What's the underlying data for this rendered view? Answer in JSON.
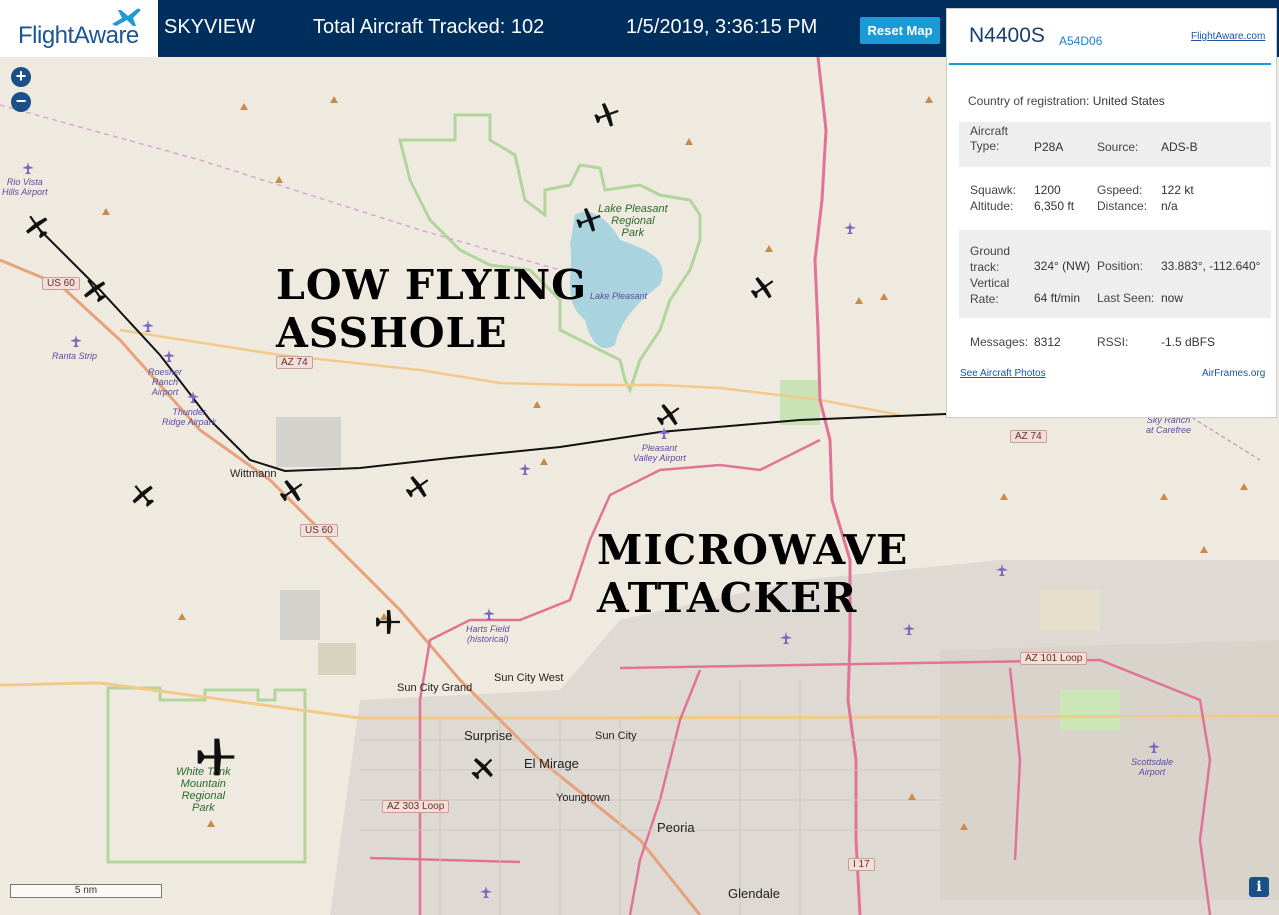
{
  "header": {
    "logo_text": "FlightAware",
    "app_name": "SKYVIEW",
    "tracked": "Total Aircraft Tracked: 102",
    "datetime": "1/5/2019, 3:36:15 PM",
    "reset_label": "Reset Map"
  },
  "map_controls": {
    "zoom_in": "+",
    "zoom_out": "−",
    "scale": "5 nm",
    "info": "i"
  },
  "annotations": {
    "low_flying_line1": "LOW FLYING",
    "low_flying_line2": "ASSHOLE",
    "microwave_line1": "MICROWAVE",
    "microwave_line2": "ATTACKER"
  },
  "map_labels": {
    "rio_vista": "Rio Vista\nHills Airport",
    "lake_pleasant_park": "Lake Pleasant\nRegional\nPark",
    "lake_pleasant": "Lake Pleasant",
    "ranta": "Ranta Strip",
    "roesner": "Roesner\nRanch\nAirport",
    "thunder": "Thunder\nRidge Airpark",
    "pleasant_valley": "Pleasant\nValley Airport",
    "sky_ranch": "Sky Ranch\nat Carefree",
    "wittmann": "Wittmann",
    "harts": "Harts Field\n(historical)",
    "sun_city_grand": "Sun City Grand",
    "sun_city_west": "Sun City West",
    "surprise": "Surprise",
    "sun_city": "Sun City",
    "el_mirage": "El Mirage",
    "youngtown": "Youngtown",
    "peoria": "Peoria",
    "glendale": "Glendale",
    "white_tank": "White Tank\nMountain\nRegional\nPark",
    "scottsdale": "Scottsdale\nAirport",
    "us60_a": "US 60",
    "us60_b": "US 60",
    "az74_a": "AZ 74",
    "az74_b": "AZ 74",
    "az101": "AZ 101 Loop",
    "az303": "AZ 303 Loop",
    "i17": "I 17"
  },
  "panel": {
    "registration": "N4400S",
    "hex": "A54D06",
    "site_link": "FlightAware.com",
    "country_label": "Country of registration:",
    "country_value": "United States",
    "aircraft_type_label": "Aircraft\nType:",
    "aircraft_type_value": "P28A",
    "source_label": "Source:",
    "source_value": "ADS-B",
    "squawk_label": "Squawk:",
    "squawk_value": "1200",
    "gspeed_label": "Gspeed:",
    "gspeed_value": "122 kt",
    "altitude_label": "Altitude:",
    "altitude_value": "6,350 ft",
    "distance_label": "Distance:",
    "distance_value": "n/a",
    "ground_track_label": "Ground\ntrack:",
    "ground_track_value": "324° (NW)",
    "position_label": "Position:",
    "position_value": "33.883°, -112.640°",
    "vertical_rate_label": "Vertical\nRate:",
    "vertical_rate_value": "64 ft/min",
    "last_seen_label": "Last Seen:",
    "last_seen_value": "now",
    "messages_label": "Messages:",
    "messages_value": "8312",
    "rssi_label": "RSSI:",
    "rssi_value": "-1.5 dBFS",
    "photos_link": "See Aircraft Photos",
    "airframes_link": "AirFrames.org"
  },
  "colors": {
    "header_bg": "#002f5d",
    "accent": "#1a9bd7",
    "map_bg": "#efeae0",
    "lake": "#a9d3df",
    "park_border": "#a6d18f",
    "highway": "#e07396"
  }
}
